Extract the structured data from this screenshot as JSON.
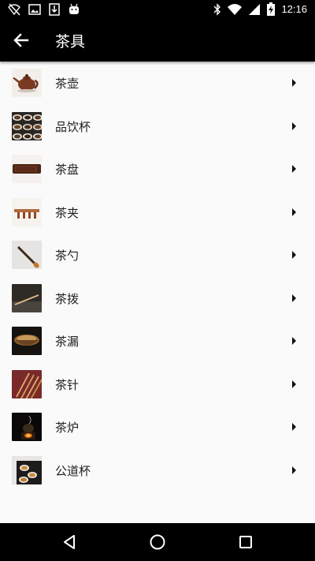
{
  "status_bar": {
    "time": "12:16",
    "icons": [
      "wifi-off-icon",
      "image-icon",
      "download-icon",
      "android-icon",
      "bluetooth-icon",
      "wifi-icon",
      "signal-icon",
      "battery-charging-icon"
    ]
  },
  "toolbar": {
    "title": "茶具",
    "back_icon": "arrow-back-icon"
  },
  "list": {
    "items": [
      {
        "label": "茶壶",
        "icon": "teapot-thumbnail"
      },
      {
        "label": "品饮杯",
        "icon": "teacups-thumbnail"
      },
      {
        "label": "茶盘",
        "icon": "tea-tray-thumbnail"
      },
      {
        "label": "茶夹",
        "icon": "tea-tongs-thumbnail"
      },
      {
        "label": "茶勺",
        "icon": "tea-spoon-thumbnail"
      },
      {
        "label": "茶拨",
        "icon": "tea-pick-thumbnail"
      },
      {
        "label": "茶漏",
        "icon": "tea-strainer-thumbnail"
      },
      {
        "label": "茶针",
        "icon": "tea-needle-thumbnail"
      },
      {
        "label": "茶炉",
        "icon": "tea-stove-thumbnail"
      },
      {
        "label": "公道杯",
        "icon": "fair-cup-thumbnail"
      }
    ],
    "chevron_icon": "chevron-right-icon"
  },
  "nav_bar": {
    "icons": [
      "back-triangle-icon",
      "home-circle-icon",
      "recents-square-icon"
    ]
  },
  "colors": {
    "bar_background": "#000000",
    "list_background": "#fafafa",
    "text": "#222222"
  }
}
